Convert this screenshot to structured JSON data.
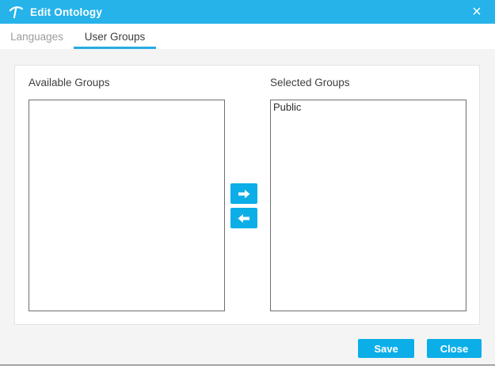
{
  "header": {
    "title": "Edit Ontology",
    "close_glyph": "×"
  },
  "tabs": [
    {
      "label": "Languages",
      "active": false
    },
    {
      "label": "User Groups",
      "active": true
    }
  ],
  "transfer": {
    "available": {
      "label": "Available Groups",
      "items": []
    },
    "selected": {
      "label": "Selected Groups",
      "items": [
        "Public"
      ]
    }
  },
  "actions": {
    "save": "Save",
    "close": "Close"
  },
  "icons": {
    "logo": "pickaxe-logo-icon",
    "close": "close-icon",
    "move_right": "arrow-right-icon",
    "move_left": "arrow-left-icon"
  },
  "colors": {
    "header_bg": "#25b3ea",
    "accent": "#0caee8",
    "tab_underline": "#29abe2",
    "body_bg": "#f4f4f4",
    "list_border": "#6f6f6f"
  }
}
